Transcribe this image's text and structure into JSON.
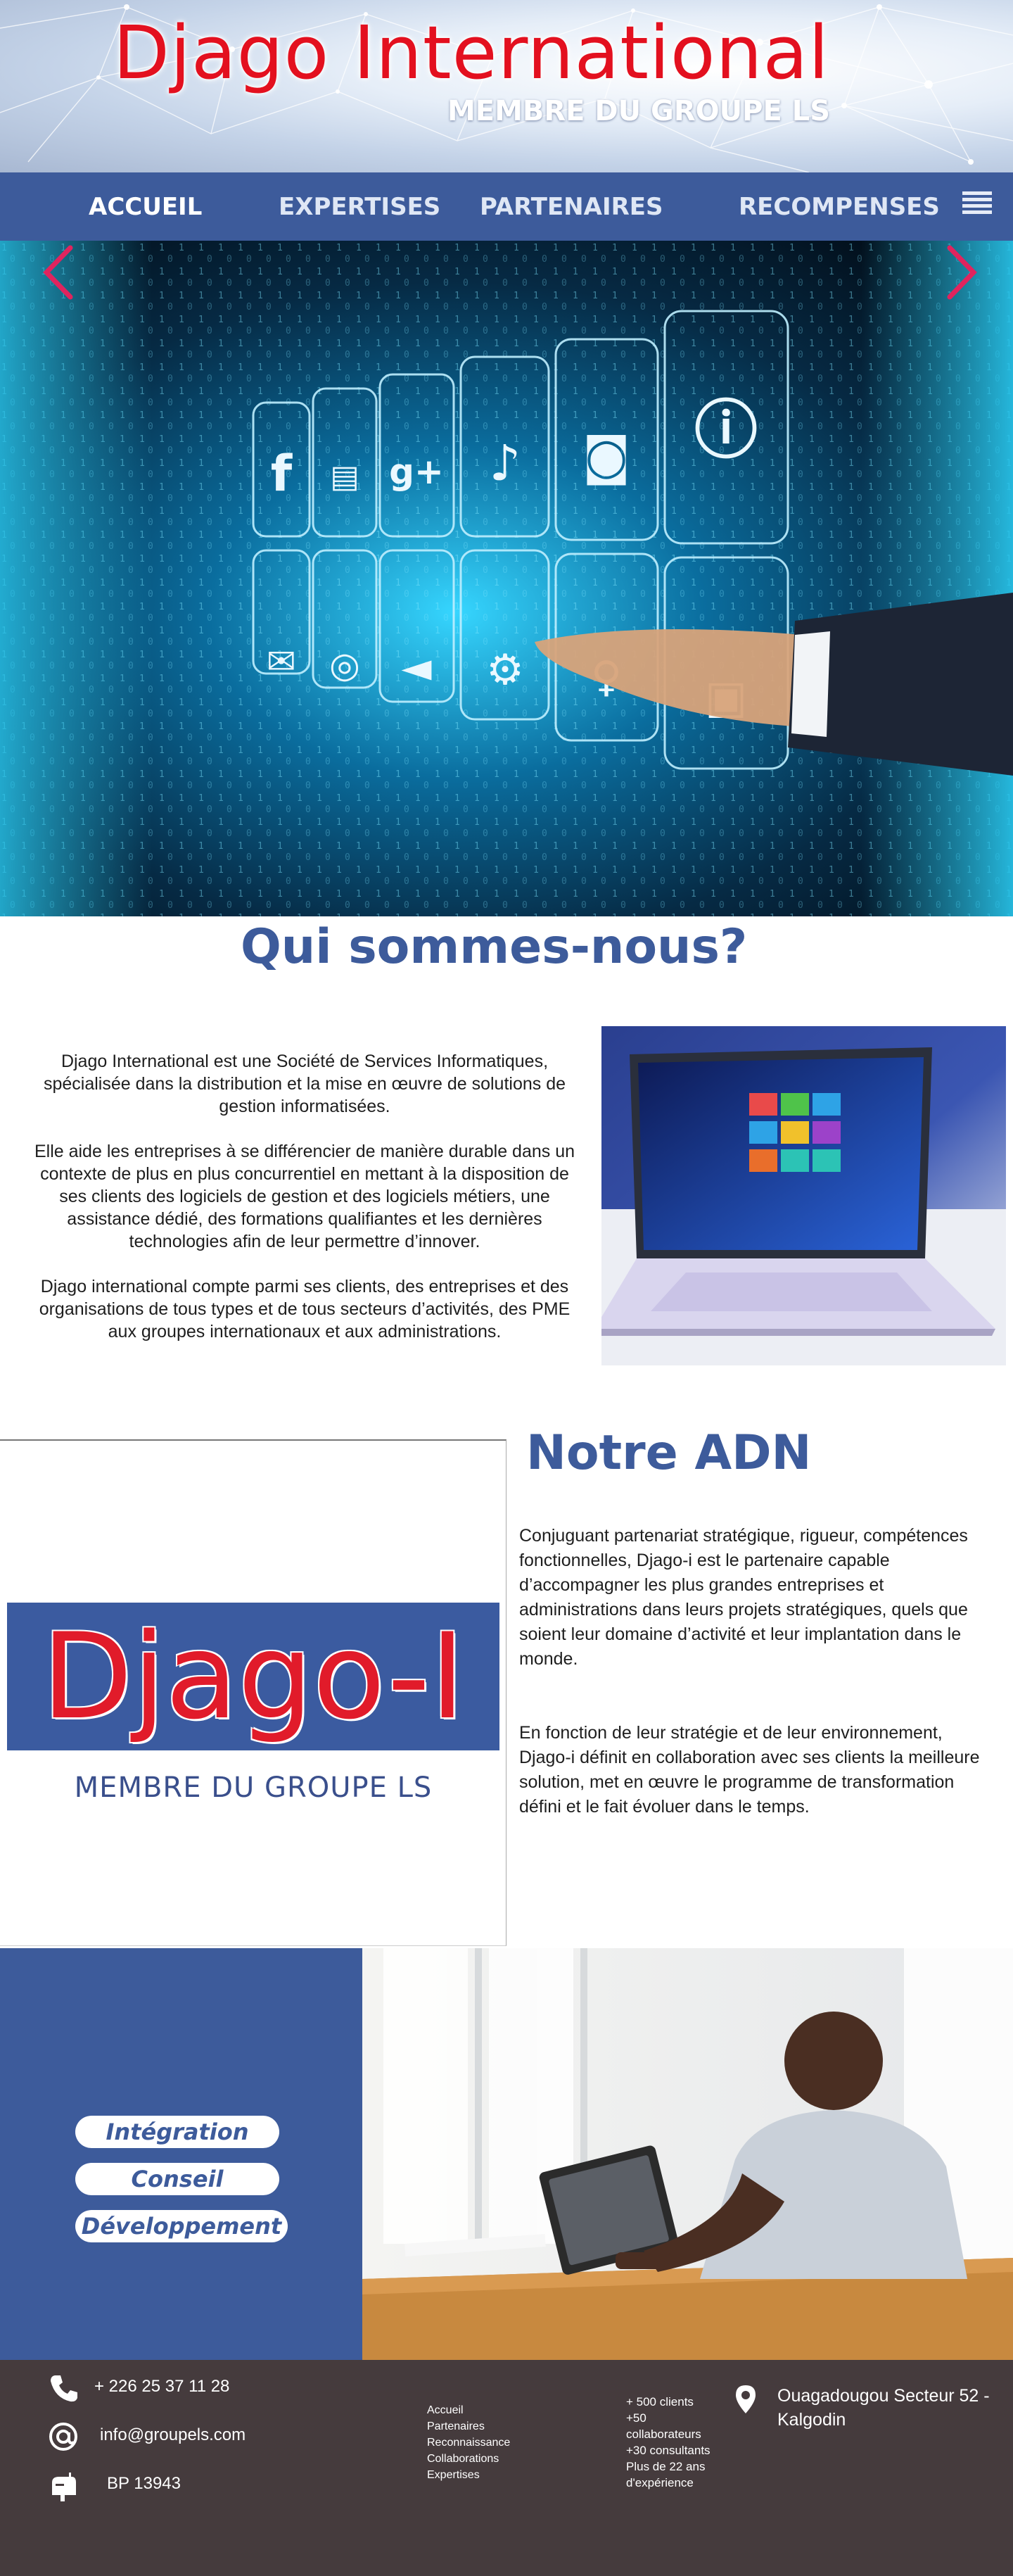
{
  "header": {
    "title": "Djago International",
    "subtitle": "MEMBRE DU GROUPE LS"
  },
  "nav": {
    "items": [
      {
        "label": "ACCUEIL",
        "active": true
      },
      {
        "label": "EXPERTISES",
        "active": false
      },
      {
        "label": "PARTENAIRES",
        "active": false
      },
      {
        "label": "RECOMPENSES",
        "active": false
      }
    ],
    "menu_icon": "hamburger-icon"
  },
  "hero": {
    "prev_icon": "chevron-left-icon",
    "next_icon": "chevron-right-icon",
    "arrow_color": "#e0245e"
  },
  "about": {
    "heading": "Qui sommes-nous?",
    "paragraphs": [
      "Djago International est une Société de Services Informatiques, spécialisée dans la distribution et la mise en œuvre de solutions de gestion informatisées.",
      "Elle aide les entreprises à se différencier de manière durable dans un contexte de plus en plus concurrentiel en mettant à la disposition de ses clients des logiciels de gestion et des logiciels métiers, une assistance dédié, des formations qualifiantes et les dernières technologies  afin de leur permettre d’innover.",
      "Djago international compte parmi ses clients, des entreprises et des organisations de tous types et de tous secteurs d’activités, des PME aux groupes internationaux et aux administrations."
    ]
  },
  "adn": {
    "heading": "Notre ADN",
    "logo_text": "Djago-I",
    "logo_tagline": "MEMBRE DU GROUPE LS",
    "paragraphs": [
      "Conjuguant partenariat stratégique, rigueur, compétences fonctionnelles, Djago-i est le partenaire capable d’accompagner les plus grandes entreprises  et administrations dans leurs projets stratégiques, quels que soient leur domaine d’activité et leur implantation dans le monde.",
      "En fonction de leur stratégie et de leur environnement, Djago-i définit en  collaboration avec ses clients la meilleure solution, met en œuvre le programme  de transformation défini et le fait évoluer dans le temps."
    ]
  },
  "services": {
    "items": [
      "Intégration",
      "Conseil",
      "Développement"
    ]
  },
  "footer": {
    "phone": "+ 226 25 37 11 28",
    "email": "info@groupels.com",
    "po_box": "BP 13943",
    "links": [
      "Accueil",
      "Partenaires",
      "Reconnaissance",
      "Collaborations",
      "Expertises"
    ],
    "stats": [
      "+ 500 clients",
      "+50",
      "collaborateurs",
      "+30 consultants",
      "Plus de 22 ans",
      "d'expérience"
    ],
    "address": "Ouagadougou Secteur 52 - Kalgodin",
    "icons": {
      "phone": "phone-icon",
      "email": "at-icon",
      "mailbox": "mailbox-icon",
      "location": "location-pin-icon"
    }
  },
  "colors": {
    "brand_blue": "#3d5b9b",
    "title_red": "#e3101f",
    "footer_bg": "#453b3d"
  }
}
